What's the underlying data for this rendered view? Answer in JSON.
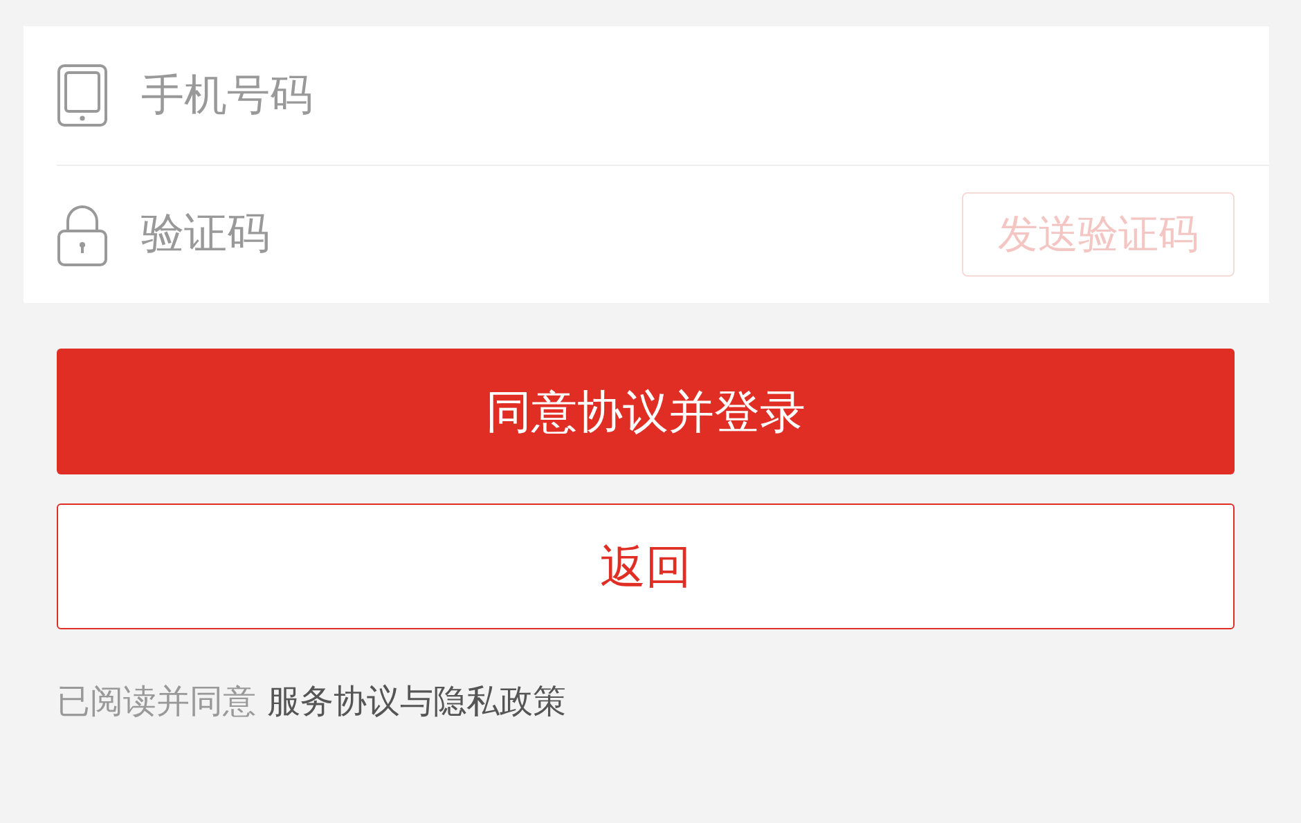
{
  "form": {
    "fields": [
      {
        "kind": "phone",
        "placeholder": "手机号码"
      },
      {
        "kind": "code",
        "placeholder": "验证码",
        "action": {
          "label": "发送验证码",
          "disabled": true
        }
      }
    ]
  },
  "buttons": [
    {
      "kind": "primary",
      "label": "同意协议并登录"
    },
    {
      "kind": "outline",
      "label": "返回"
    }
  ],
  "agreement": {
    "text": "已阅读并同意",
    "link": "服务协议与隐私政策"
  }
}
